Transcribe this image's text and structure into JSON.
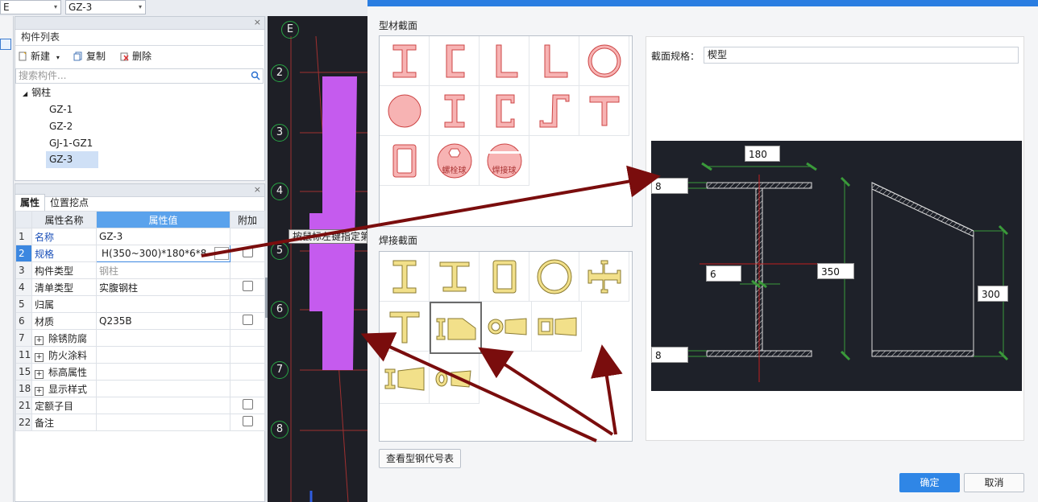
{
  "top_combos": {
    "left_value": "E",
    "right_value": "GZ-3"
  },
  "component_panel": {
    "title": "构件列表",
    "buttons": {
      "new": "新建",
      "copy": "复制",
      "delete": "删除"
    },
    "search_placeholder": "搜索构件...",
    "tree": {
      "root": "钢柱",
      "items": [
        "GZ-1",
        "GZ-2",
        "GJ-1-GZ1",
        "GZ-3"
      ],
      "selected": "GZ-3"
    }
  },
  "property_panel": {
    "tabs": [
      "属性",
      "位置挖点"
    ],
    "headers": {
      "num": "",
      "name": "属性名称",
      "value": "属性值",
      "extra": "附加"
    },
    "rows": [
      {
        "num": "1",
        "name": "名称",
        "value": "GZ-3"
      },
      {
        "num": "2",
        "name": "规格",
        "value": "H(350~300)*180*6*8"
      },
      {
        "num": "3",
        "name": "构件类型",
        "value": "钢柱"
      },
      {
        "num": "4",
        "name": "清单类型",
        "value": "实腹钢柱"
      },
      {
        "num": "5",
        "name": "归属",
        "value": ""
      },
      {
        "num": "6",
        "name": "材质",
        "value": "Q235B"
      },
      {
        "num": "7",
        "name": "除锈防腐",
        "value": ""
      },
      {
        "num": "11",
        "name": "防火涂料",
        "value": ""
      },
      {
        "num": "15",
        "name": "标高属性",
        "value": ""
      },
      {
        "num": "18",
        "name": "显示样式",
        "value": ""
      },
      {
        "num": "21",
        "name": "定额子目",
        "value": ""
      },
      {
        "num": "22",
        "name": "备注",
        "value": ""
      }
    ],
    "ellipsis": "···"
  },
  "canvas": {
    "axes": [
      "E",
      "2",
      "3",
      "4",
      "5",
      "6",
      "7",
      "8"
    ],
    "tooltip": "按鼠标左键指定第"
  },
  "dialog": {
    "section_profile": "型材截面",
    "section_welded": "焊接截面",
    "ball_bolt": "螺栓球",
    "ball_weld": "焊接球",
    "spec_label": "截面规格：",
    "spec_value": "楔型",
    "dims": {
      "top_width": "180",
      "flange_top": "8",
      "web": "6",
      "height_start": "350",
      "height_end": "300",
      "flange_bottom": "8"
    },
    "btn_view_table": "查看型钢代号表",
    "btn_ok": "确定",
    "btn_cancel": "取消"
  },
  "colors": {
    "accent": "#2f86e6",
    "profile_fill": "#f7b3b3",
    "weld_fill": "#f2e08a",
    "column": "#c55bee",
    "arrow": "#7a0d0d",
    "axis_ring": "#28a745"
  }
}
